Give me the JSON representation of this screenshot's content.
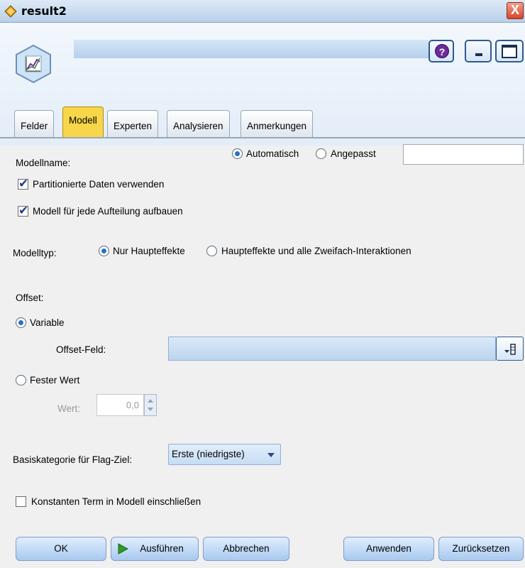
{
  "window": {
    "title": "result2",
    "close_glyph": "X"
  },
  "header": {
    "help_glyph": "?"
  },
  "tabs": [
    {
      "label": "Felder"
    },
    {
      "label": "Modell"
    },
    {
      "label": "Experten"
    },
    {
      "label": "Analysieren"
    },
    {
      "label": "Anmerkungen"
    }
  ],
  "model": {
    "modellname_label": "Modellname:",
    "auto_label": "Automatisch",
    "custom_label": "Angepasst",
    "custom_value": "",
    "partitioned_label": "Partitionierte Daten verwenden",
    "partitioned_checked": true,
    "split_label": "Modell für jede Aufteilung aufbauen",
    "split_checked": true,
    "modelltyp_label": "Modelltyp:",
    "main_effects_label": "Nur Haupteffekte",
    "interactions_label": "Haupteffekte und alle Zweifach-Interaktionen",
    "offset_label": "Offset:",
    "variable_label": "Variable",
    "offset_field_label": "Offset-Feld:",
    "offset_field_value": "",
    "fixed_label": "Fester Wert",
    "wert_label": "Wert:",
    "wert_value": "0,0",
    "base_cat_label": "Basiskategorie für Flag-Ziel:",
    "base_cat_value": "Erste (niedrigste)",
    "constant_label": "Konstanten Term in Modell einschließen",
    "constant_checked": false
  },
  "buttons": {
    "ok": "OK",
    "run": "Ausführen",
    "cancel": "Abbrechen",
    "apply": "Anwenden",
    "reset": "Zurücksetzen"
  },
  "colors": {
    "active_tab": "#f7d64a",
    "field_blue": "#c6dcf4",
    "run_green": "#2a9a2a"
  }
}
